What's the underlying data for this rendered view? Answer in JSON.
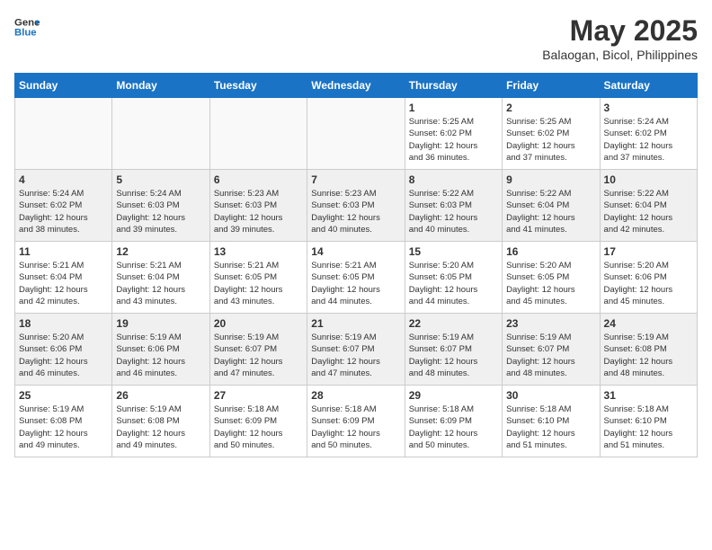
{
  "header": {
    "logo_line1": "General",
    "logo_line2": "Blue",
    "month_year": "May 2025",
    "location": "Balaogan, Bicol, Philippines"
  },
  "weekdays": [
    "Sunday",
    "Monday",
    "Tuesday",
    "Wednesday",
    "Thursday",
    "Friday",
    "Saturday"
  ],
  "weeks": [
    [
      {
        "day": "",
        "info": ""
      },
      {
        "day": "",
        "info": ""
      },
      {
        "day": "",
        "info": ""
      },
      {
        "day": "",
        "info": ""
      },
      {
        "day": "1",
        "info": "Sunrise: 5:25 AM\nSunset: 6:02 PM\nDaylight: 12 hours\nand 36 minutes."
      },
      {
        "day": "2",
        "info": "Sunrise: 5:25 AM\nSunset: 6:02 PM\nDaylight: 12 hours\nand 37 minutes."
      },
      {
        "day": "3",
        "info": "Sunrise: 5:24 AM\nSunset: 6:02 PM\nDaylight: 12 hours\nand 37 minutes."
      }
    ],
    [
      {
        "day": "4",
        "info": "Sunrise: 5:24 AM\nSunset: 6:02 PM\nDaylight: 12 hours\nand 38 minutes."
      },
      {
        "day": "5",
        "info": "Sunrise: 5:24 AM\nSunset: 6:03 PM\nDaylight: 12 hours\nand 39 minutes."
      },
      {
        "day": "6",
        "info": "Sunrise: 5:23 AM\nSunset: 6:03 PM\nDaylight: 12 hours\nand 39 minutes."
      },
      {
        "day": "7",
        "info": "Sunrise: 5:23 AM\nSunset: 6:03 PM\nDaylight: 12 hours\nand 40 minutes."
      },
      {
        "day": "8",
        "info": "Sunrise: 5:22 AM\nSunset: 6:03 PM\nDaylight: 12 hours\nand 40 minutes."
      },
      {
        "day": "9",
        "info": "Sunrise: 5:22 AM\nSunset: 6:04 PM\nDaylight: 12 hours\nand 41 minutes."
      },
      {
        "day": "10",
        "info": "Sunrise: 5:22 AM\nSunset: 6:04 PM\nDaylight: 12 hours\nand 42 minutes."
      }
    ],
    [
      {
        "day": "11",
        "info": "Sunrise: 5:21 AM\nSunset: 6:04 PM\nDaylight: 12 hours\nand 42 minutes."
      },
      {
        "day": "12",
        "info": "Sunrise: 5:21 AM\nSunset: 6:04 PM\nDaylight: 12 hours\nand 43 minutes."
      },
      {
        "day": "13",
        "info": "Sunrise: 5:21 AM\nSunset: 6:05 PM\nDaylight: 12 hours\nand 43 minutes."
      },
      {
        "day": "14",
        "info": "Sunrise: 5:21 AM\nSunset: 6:05 PM\nDaylight: 12 hours\nand 44 minutes."
      },
      {
        "day": "15",
        "info": "Sunrise: 5:20 AM\nSunset: 6:05 PM\nDaylight: 12 hours\nand 44 minutes."
      },
      {
        "day": "16",
        "info": "Sunrise: 5:20 AM\nSunset: 6:05 PM\nDaylight: 12 hours\nand 45 minutes."
      },
      {
        "day": "17",
        "info": "Sunrise: 5:20 AM\nSunset: 6:06 PM\nDaylight: 12 hours\nand 45 minutes."
      }
    ],
    [
      {
        "day": "18",
        "info": "Sunrise: 5:20 AM\nSunset: 6:06 PM\nDaylight: 12 hours\nand 46 minutes."
      },
      {
        "day": "19",
        "info": "Sunrise: 5:19 AM\nSunset: 6:06 PM\nDaylight: 12 hours\nand 46 minutes."
      },
      {
        "day": "20",
        "info": "Sunrise: 5:19 AM\nSunset: 6:07 PM\nDaylight: 12 hours\nand 47 minutes."
      },
      {
        "day": "21",
        "info": "Sunrise: 5:19 AM\nSunset: 6:07 PM\nDaylight: 12 hours\nand 47 minutes."
      },
      {
        "day": "22",
        "info": "Sunrise: 5:19 AM\nSunset: 6:07 PM\nDaylight: 12 hours\nand 48 minutes."
      },
      {
        "day": "23",
        "info": "Sunrise: 5:19 AM\nSunset: 6:07 PM\nDaylight: 12 hours\nand 48 minutes."
      },
      {
        "day": "24",
        "info": "Sunrise: 5:19 AM\nSunset: 6:08 PM\nDaylight: 12 hours\nand 48 minutes."
      }
    ],
    [
      {
        "day": "25",
        "info": "Sunrise: 5:19 AM\nSunset: 6:08 PM\nDaylight: 12 hours\nand 49 minutes."
      },
      {
        "day": "26",
        "info": "Sunrise: 5:19 AM\nSunset: 6:08 PM\nDaylight: 12 hours\nand 49 minutes."
      },
      {
        "day": "27",
        "info": "Sunrise: 5:18 AM\nSunset: 6:09 PM\nDaylight: 12 hours\nand 50 minutes."
      },
      {
        "day": "28",
        "info": "Sunrise: 5:18 AM\nSunset: 6:09 PM\nDaylight: 12 hours\nand 50 minutes."
      },
      {
        "day": "29",
        "info": "Sunrise: 5:18 AM\nSunset: 6:09 PM\nDaylight: 12 hours\nand 50 minutes."
      },
      {
        "day": "30",
        "info": "Sunrise: 5:18 AM\nSunset: 6:10 PM\nDaylight: 12 hours\nand 51 minutes."
      },
      {
        "day": "31",
        "info": "Sunrise: 5:18 AM\nSunset: 6:10 PM\nDaylight: 12 hours\nand 51 minutes."
      }
    ]
  ]
}
